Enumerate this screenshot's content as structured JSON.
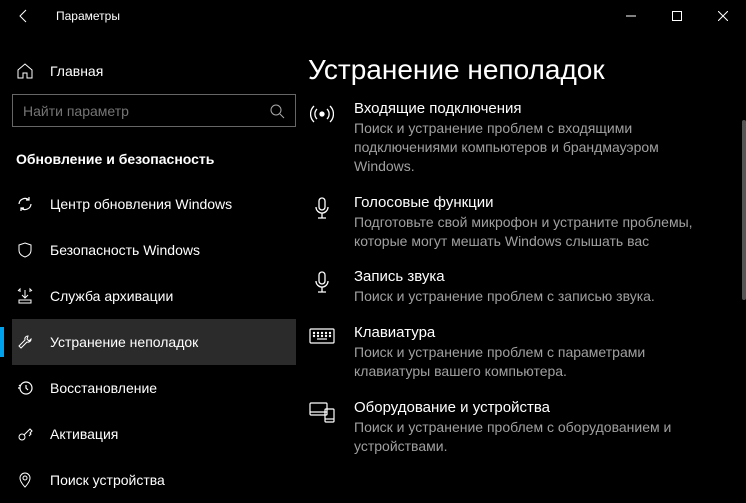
{
  "window": {
    "title": "Параметры"
  },
  "sidebar": {
    "home": "Главная",
    "search_placeholder": "Найти параметр",
    "section": "Обновление и безопасность",
    "items": [
      {
        "label": "Центр обновления Windows"
      },
      {
        "label": "Безопасность Windows"
      },
      {
        "label": "Служба архивации"
      },
      {
        "label": "Устранение неполадок"
      },
      {
        "label": "Восстановление"
      },
      {
        "label": "Активация"
      },
      {
        "label": "Поиск устройства"
      }
    ]
  },
  "main": {
    "heading": "Устранение неполадок",
    "items": [
      {
        "title": "Входящие подключения",
        "desc": "Поиск и устранение проблем с входящими подключениями компьютеров и брандмауэром Windows."
      },
      {
        "title": "Голосовые функции",
        "desc": "Подготовьте свой микрофон и устраните проблемы, которые могут мешать Windows слышать вас"
      },
      {
        "title": "Запись звука",
        "desc": "Поиск и устранение проблем с записью звука."
      },
      {
        "title": "Клавиатура",
        "desc": "Поиск и устранение проблем с параметрами клавиатуры вашего компьютера."
      },
      {
        "title": "Оборудование и устройства",
        "desc": "Поиск и устранение проблем с оборудованием и устройствами."
      }
    ]
  }
}
